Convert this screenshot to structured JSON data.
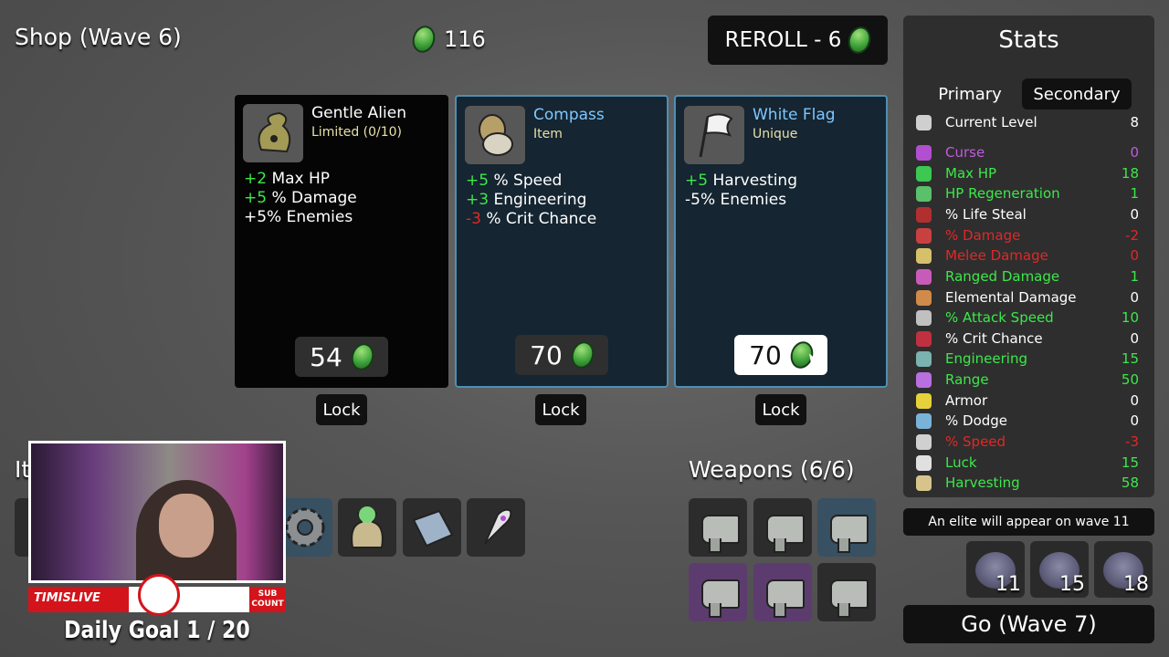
{
  "header": {
    "title": "Shop (Wave 6)",
    "gold": "116",
    "reroll_label": "REROLL - 6"
  },
  "shop": [
    {
      "name": "Gentle Alien",
      "subtitle": "Limited (0/10)",
      "price": "54",
      "lock": "Lock",
      "effects": [
        {
          "sign": "+2",
          "text": " Max HP"
        },
        {
          "sign": "+5",
          "text": " % Damage"
        },
        {
          "sign": "",
          "text": "+5% Enemies"
        }
      ]
    },
    {
      "name": "Compass",
      "subtitle": "Item",
      "price": "70",
      "lock": "Lock",
      "effects": [
        {
          "sign": "+5",
          "text": " % Speed"
        },
        {
          "sign": "+3",
          "text": " Engineering"
        },
        {
          "sign": "-3",
          "text": " % Crit Chance"
        }
      ]
    },
    {
      "name": "White Flag",
      "subtitle": "Unique",
      "price": "70",
      "lock": "Lock",
      "effects": [
        {
          "sign": "+5",
          "text": " Harvesting"
        },
        {
          "sign": "",
          "text": "-5% Enemies"
        }
      ]
    }
  ],
  "stats": {
    "title": "Stats",
    "tabs": [
      "Primary",
      "Secondary"
    ],
    "rows": [
      {
        "label": "Current Level",
        "value": "8",
        "color": "#ffffff"
      },
      {
        "label": "Curse",
        "value": "0",
        "color": "#c05bdc"
      },
      {
        "label": "Max HP",
        "value": "18",
        "color": "#3de84a"
      },
      {
        "label": "HP Regeneration",
        "value": "1",
        "color": "#3de84a"
      },
      {
        "label": "% Life Steal",
        "value": "0",
        "color": "#ffffff"
      },
      {
        "label": "% Damage",
        "value": "-2",
        "color": "#e02828"
      },
      {
        "label": "Melee Damage",
        "value": "0",
        "color": "#e02828"
      },
      {
        "label": "Ranged Damage",
        "value": "1",
        "color": "#3de84a"
      },
      {
        "label": "Elemental Damage",
        "value": "0",
        "color": "#ffffff"
      },
      {
        "label": "% Attack Speed",
        "value": "10",
        "color": "#3de84a"
      },
      {
        "label": "% Crit Chance",
        "value": "0",
        "color": "#ffffff"
      },
      {
        "label": "Engineering",
        "value": "15",
        "color": "#3de84a"
      },
      {
        "label": "Range",
        "value": "50",
        "color": "#3de84a"
      },
      {
        "label": "Armor",
        "value": "0",
        "color": "#ffffff"
      },
      {
        "label": "% Dodge",
        "value": "0",
        "color": "#ffffff"
      },
      {
        "label": "% Speed",
        "value": "-3",
        "color": "#e02828"
      },
      {
        "label": "Luck",
        "value": "15",
        "color": "#3de84a"
      },
      {
        "label": "Harvesting",
        "value": "58",
        "color": "#3de84a"
      }
    ]
  },
  "elite_notice": "An elite will appear on wave 11",
  "enemies": [
    "11",
    "15",
    "18"
  ],
  "go_button": "Go (Wave 7)",
  "weapons_title": "Weapons (6/6)",
  "items_label_partial": "It",
  "stream": {
    "tag": "TIMISLIVE",
    "sub_count": "SUB COUNT",
    "daily_goal": "Daily Goal  1 / 20"
  }
}
